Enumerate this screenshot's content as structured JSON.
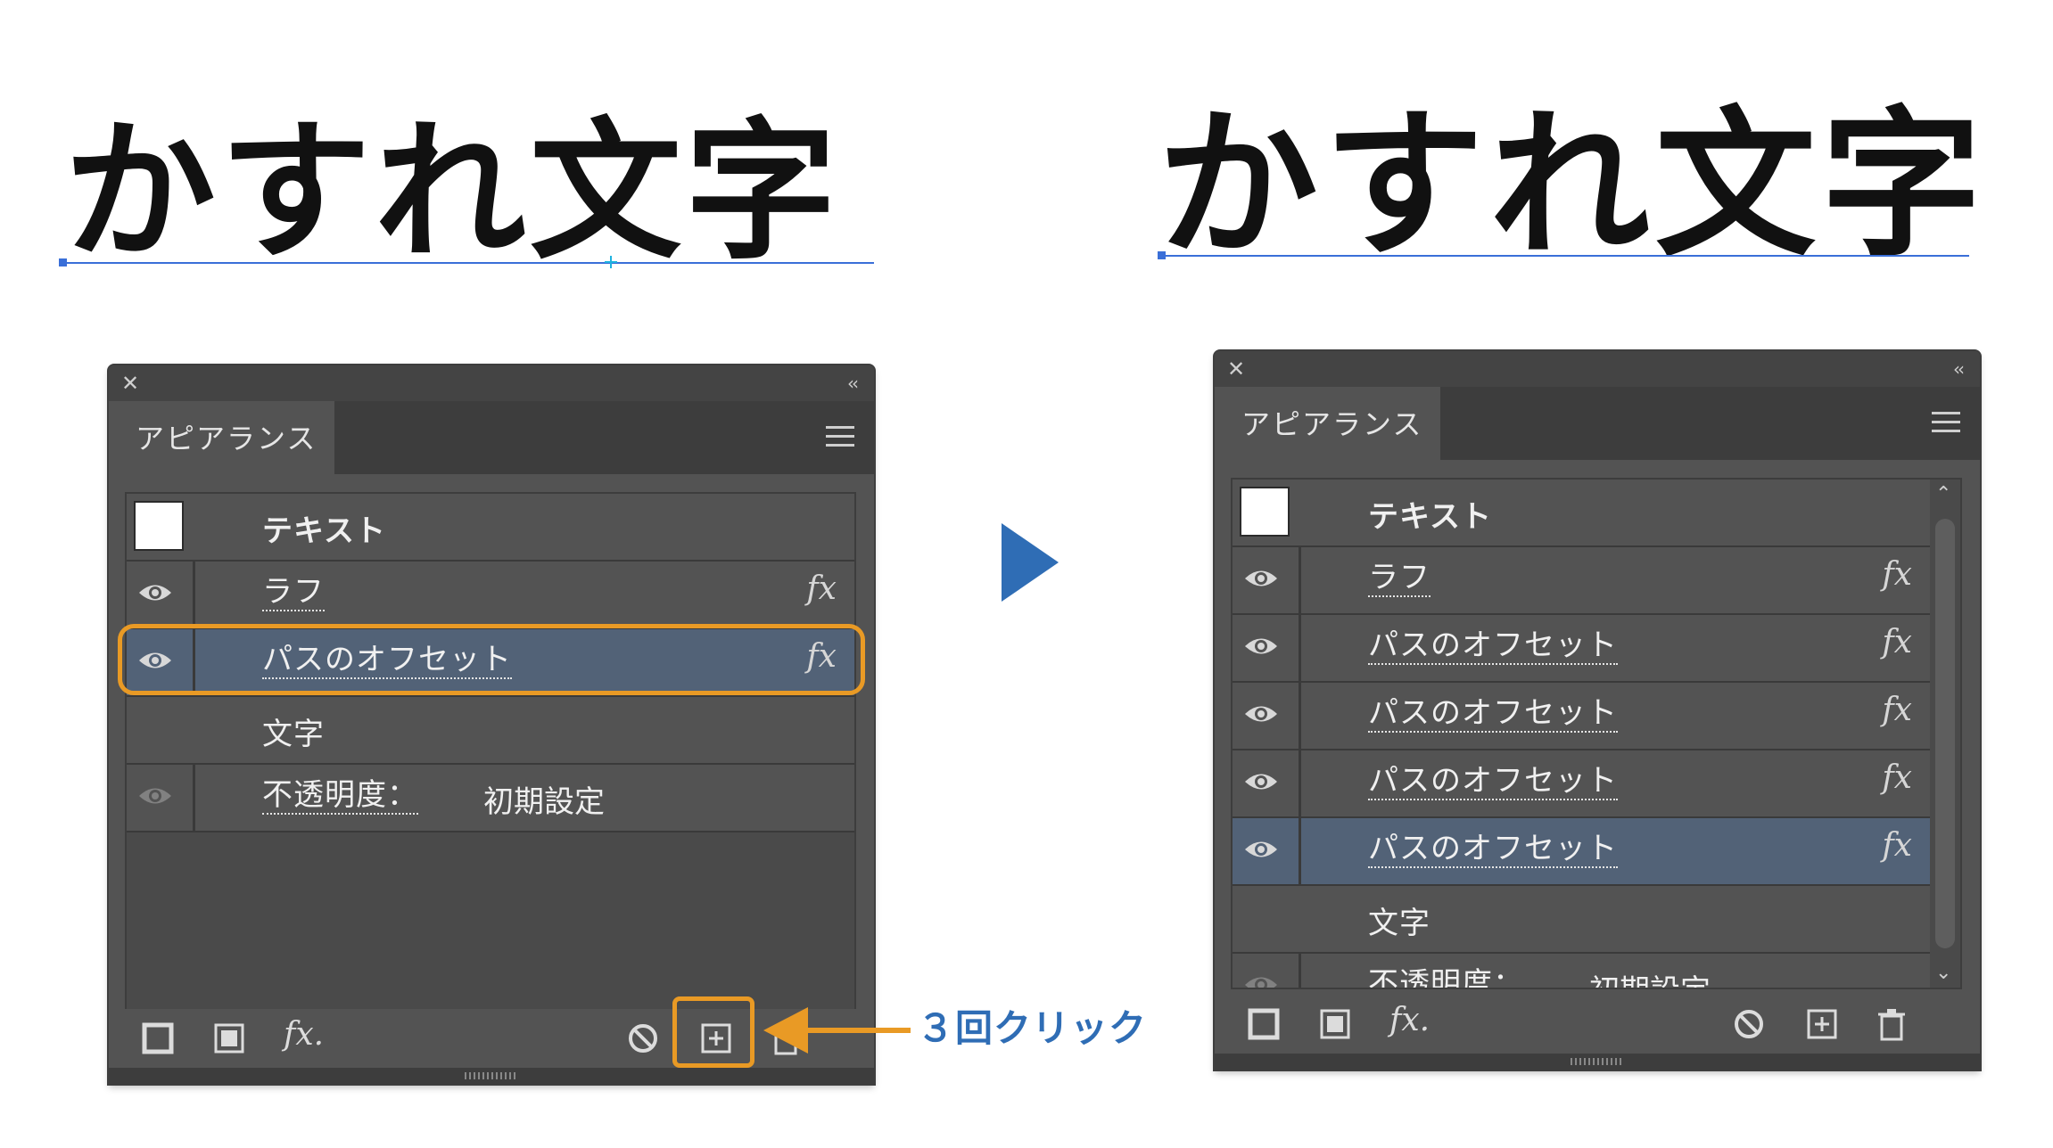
{
  "heading_text": "かすれ文字",
  "callout_text": "３回クリック",
  "colors": {
    "accent_orange": "#e99a25",
    "accent_blue": "#2f6db5",
    "selected_row": "#526277",
    "panel": "#535353"
  },
  "left_panel": {
    "title": "アピアランス",
    "rows": [
      {
        "label": "テキスト",
        "type": "header"
      },
      {
        "label": "ラフ",
        "fx": "fx",
        "eye": true
      },
      {
        "label": "パスのオフセット",
        "fx": "fx",
        "eye": true,
        "selected": true,
        "highlighted": true
      },
      {
        "label": "文字",
        "type": "plain"
      },
      {
        "label": "不透明度：",
        "value": "初期設定",
        "eye": "dim"
      }
    ],
    "toolbar": [
      "add-stroke-icon",
      "add-fill-icon",
      "add-effect-icon",
      "clear-appearance-icon",
      "duplicate-item-icon",
      "delete-item-icon"
    ],
    "fx_menu_label": "fx."
  },
  "right_panel": {
    "title": "アピアランス",
    "rows": [
      {
        "label": "テキスト",
        "type": "header"
      },
      {
        "label": "ラフ",
        "fx": "fx",
        "eye": true
      },
      {
        "label": "パスのオフセット",
        "fx": "fx",
        "eye": true
      },
      {
        "label": "パスのオフセット",
        "fx": "fx",
        "eye": true
      },
      {
        "label": "パスのオフセット",
        "fx": "fx",
        "eye": true
      },
      {
        "label": "パスのオフセット",
        "fx": "fx",
        "eye": true,
        "selected": true
      },
      {
        "label": "文字",
        "type": "plain"
      },
      {
        "label": "不透明度：",
        "value": "初期設定",
        "eye": "dim"
      }
    ],
    "fx_menu_label": "fx."
  }
}
